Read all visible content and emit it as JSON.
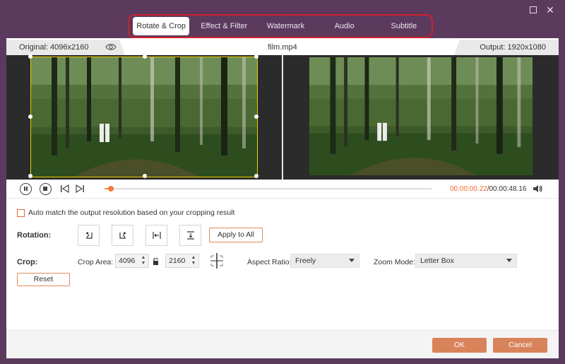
{
  "window": {
    "maximize_icon": "maximize-icon",
    "close_icon": "close-icon",
    "close_glyph": "✕"
  },
  "tabs": [
    {
      "label": "Rotate & Crop",
      "active": true
    },
    {
      "label": "Effect & Filter",
      "active": false
    },
    {
      "label": "Watermark",
      "active": false
    },
    {
      "label": "Audio",
      "active": false
    },
    {
      "label": "Subtitle",
      "active": false
    }
  ],
  "info": {
    "original": "Original: 4096x2160",
    "filename": "film.mp4",
    "output": "Output: 1920x1080",
    "eye_icon": "eye-icon"
  },
  "playback": {
    "current_time": "00:00:00.22",
    "separator": "/",
    "total_time": "00:00:48.16",
    "progress": 0.004
  },
  "settings": {
    "auto_match_label": "Auto match the output resolution based on your cropping result",
    "auto_match_checked": false,
    "rotation_label": "Rotation:",
    "rotation_icons": [
      "rotate-left-icon",
      "rotate-right-icon",
      "flip-horizontal-icon",
      "flip-vertical-icon"
    ],
    "apply_to_all": "Apply to All",
    "crop_label": "Crop:",
    "crop_area_label": "Crop Area:",
    "crop_width": "4096",
    "crop_height": "2160",
    "aspect_ratio_label": "Aspect Ratio:",
    "aspect_ratio_value": "Freely",
    "zoom_mode_label": "Zoom Mode:",
    "zoom_mode_value": "Letter Box",
    "reset": "Reset"
  },
  "footer": {
    "ok": "OK",
    "cancel": "Cancel"
  },
  "colors": {
    "accent": "#d9835a",
    "highlight": "#d0202a",
    "crop_border": "#f0d000",
    "time_current": "#f06a30",
    "bg": "#5b3a5e"
  }
}
